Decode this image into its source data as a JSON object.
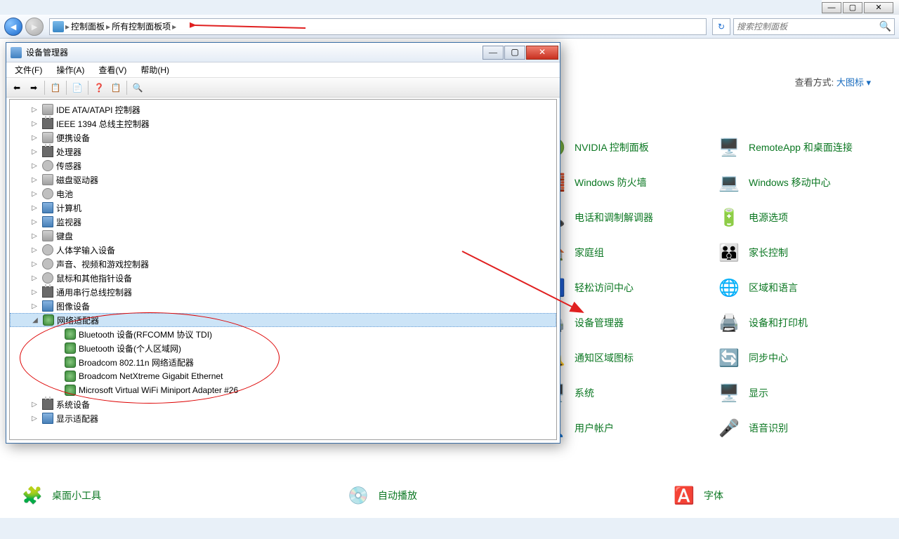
{
  "titlebar": {
    "min": "—",
    "max": "▢",
    "close": "✕"
  },
  "nav": {
    "back": "◄",
    "forward": "►",
    "path": [
      "控制面板",
      "所有控制面板项"
    ],
    "sep": "▸",
    "refresh": "↻",
    "search_placeholder": "搜索控制面板",
    "search_icon": "🔍"
  },
  "controlpanel": {
    "view_label": "查看方式:",
    "view_value": "大图标 ▾",
    "items_right": [
      {
        "label": "NVIDIA 控制面板",
        "icon": "🟢"
      },
      {
        "label": "RemoteApp 和桌面连接",
        "icon": "🖥️"
      },
      {
        "label": "Windows 防火墙",
        "icon": "🧱"
      },
      {
        "label": "Windows 移动中心",
        "icon": "💻"
      },
      {
        "label": "电话和调制解调器",
        "icon": "📞"
      },
      {
        "label": "电源选项",
        "icon": "🔋"
      },
      {
        "label": "家庭组",
        "icon": "🏠"
      },
      {
        "label": "家长控制",
        "icon": "👪"
      },
      {
        "label": "轻松访问中心",
        "icon": "♿"
      },
      {
        "label": "区域和语言",
        "icon": "🌐"
      },
      {
        "label": "设备管理器",
        "icon": "🖨️"
      },
      {
        "label": "设备和打印机",
        "icon": "🖨️"
      },
      {
        "label": "通知区域图标",
        "icon": "🔔"
      },
      {
        "label": "同步中心",
        "icon": "🔄"
      },
      {
        "label": "系统",
        "icon": "🖥️"
      },
      {
        "label": "显示",
        "icon": "🖥️"
      },
      {
        "label": "用户帐户",
        "icon": "👤"
      },
      {
        "label": "语音识别",
        "icon": "🎤"
      }
    ],
    "items_bottom": [
      {
        "label": "桌面小工具",
        "icon": "🧩"
      },
      {
        "label": "自动播放",
        "icon": "💿"
      },
      {
        "label": "字体",
        "icon": "🅰️"
      }
    ]
  },
  "devmgr": {
    "title": "设备管理器",
    "menus": [
      "文件(F)",
      "操作(A)",
      "查看(V)",
      "帮助(H)"
    ],
    "toolbar_icons": [
      "⬅",
      "➡",
      "|",
      "📋",
      "|",
      "📄",
      "|",
      "❓",
      "📋",
      "|",
      "🔍"
    ],
    "tb_min": "—",
    "tb_max": "▢",
    "tb_close": "✕",
    "tree": [
      {
        "lvl": 2,
        "exp": "▷",
        "cls": "i-hdd",
        "label": "IDE ATA/ATAPI 控制器"
      },
      {
        "lvl": 2,
        "exp": "▷",
        "cls": "i-chip",
        "label": "IEEE 1394 总线主控制器"
      },
      {
        "lvl": 2,
        "exp": "▷",
        "cls": "i-hdd",
        "label": "便携设备"
      },
      {
        "lvl": 2,
        "exp": "▷",
        "cls": "i-chip",
        "label": "处理器"
      },
      {
        "lvl": 2,
        "exp": "▷",
        "cls": "i-gear",
        "label": "传感器"
      },
      {
        "lvl": 2,
        "exp": "▷",
        "cls": "i-hdd",
        "label": "磁盘驱动器"
      },
      {
        "lvl": 2,
        "exp": "▷",
        "cls": "i-gear",
        "label": "电池"
      },
      {
        "lvl": 2,
        "exp": "▷",
        "cls": "i-disp",
        "label": "计算机"
      },
      {
        "lvl": 2,
        "exp": "▷",
        "cls": "i-disp",
        "label": "监视器"
      },
      {
        "lvl": 2,
        "exp": "▷",
        "cls": "i-hdd",
        "label": "键盘"
      },
      {
        "lvl": 2,
        "exp": "▷",
        "cls": "i-gear",
        "label": "人体学输入设备"
      },
      {
        "lvl": 2,
        "exp": "▷",
        "cls": "i-gear",
        "label": "声音、视频和游戏控制器"
      },
      {
        "lvl": 2,
        "exp": "▷",
        "cls": "i-gear",
        "label": "鼠标和其他指针设备"
      },
      {
        "lvl": 2,
        "exp": "▷",
        "cls": "i-chip",
        "label": "通用串行总线控制器"
      },
      {
        "lvl": 2,
        "exp": "▷",
        "cls": "i-disp",
        "label": "图像设备"
      },
      {
        "lvl": 2,
        "exp": "◢",
        "cls": "i-net",
        "label": "网络适配器",
        "sel": true
      },
      {
        "lvl": 3,
        "exp": "",
        "cls": "i-net",
        "label": "Bluetooth 设备(RFCOMM 协议 TDI)"
      },
      {
        "lvl": 3,
        "exp": "",
        "cls": "i-net",
        "label": "Bluetooth 设备(个人区域网)"
      },
      {
        "lvl": 3,
        "exp": "",
        "cls": "i-net",
        "label": "Broadcom 802.11n 网络适配器"
      },
      {
        "lvl": 3,
        "exp": "",
        "cls": "i-net",
        "label": "Broadcom NetXtreme Gigabit Ethernet"
      },
      {
        "lvl": 3,
        "exp": "",
        "cls": "i-net",
        "label": "Microsoft Virtual WiFi Miniport Adapter #26"
      },
      {
        "lvl": 2,
        "exp": "▷",
        "cls": "i-chip",
        "label": "系统设备"
      },
      {
        "lvl": 2,
        "exp": "▷",
        "cls": "i-disp",
        "label": "显示适配器"
      }
    ]
  }
}
